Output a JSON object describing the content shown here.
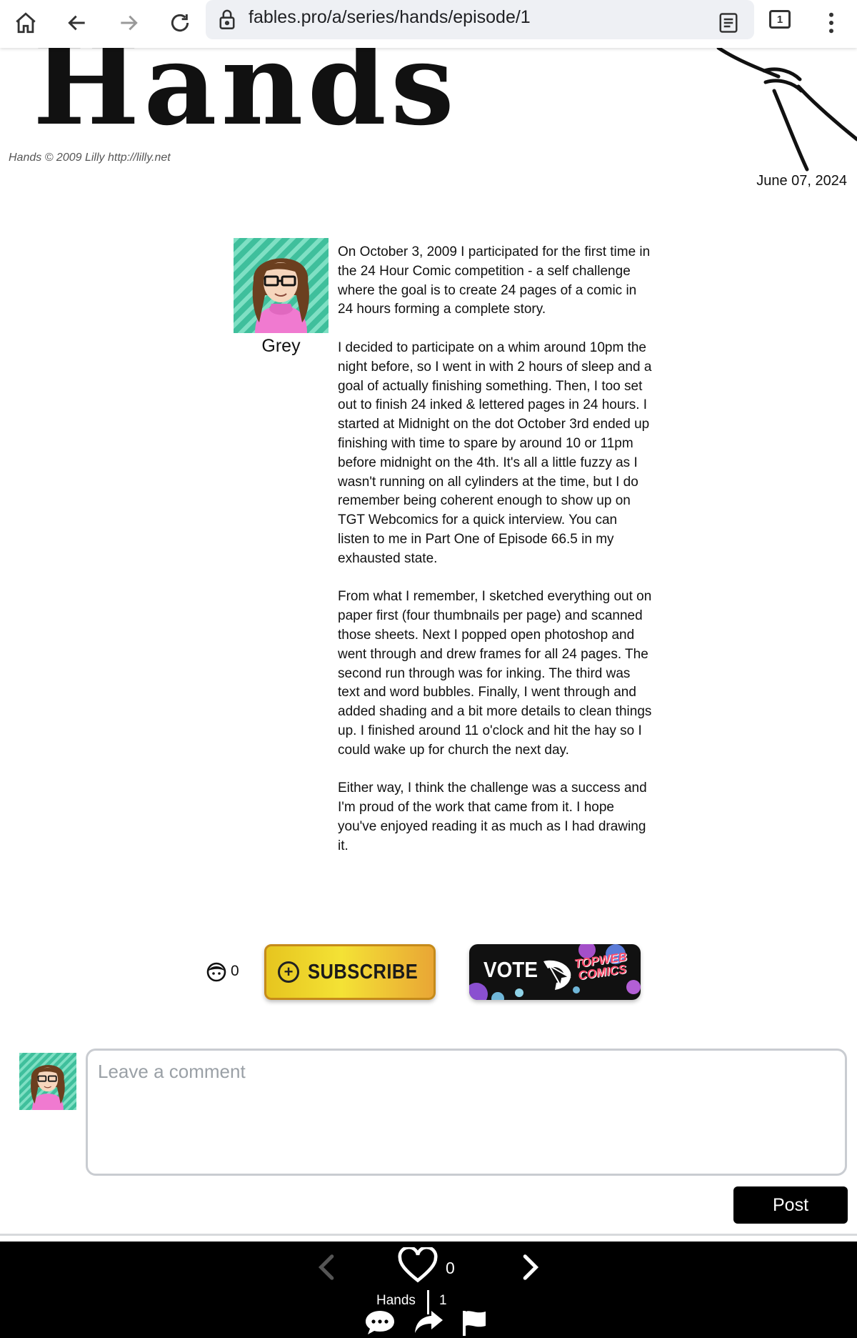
{
  "browser": {
    "url": "fables.pro/a/series/hands/episode/1",
    "tab_count": "1"
  },
  "banner": {
    "title": "Hands",
    "copyright": "Hands © 2009 Lilly http://lilly.net"
  },
  "post": {
    "date": "June 07, 2024",
    "author": "Grey",
    "paragraphs": [
      "On October 3, 2009 I participated for the first time in the 24 Hour Comic competition - a self challenge where the goal is to create 24 pages of a comic in 24 hours forming a complete story.",
      "I decided to participate on a whim around 10pm the night before, so I went in with 2 hours of sleep and a goal of actually finishing something. Then, I too set out to finish 24 inked & lettered pages in 24 hours. I started at Midnight on the dot October 3rd ended up finishing with time to spare by around 10 or 11pm before midnight on the 4th. It's all a little fuzzy as I wasn't running on all cylinders at the time, but I do remember being coherent enough to show up on TGT Webcomics for a quick interview. You can listen to me in Part One of Episode 66.5 in my exhausted state.",
      "From what I remember, I sketched everything out on paper first (four thumbnails per page) and scanned those sheets. Next I popped open photoshop and went through and drew frames for all 24 pages. The second run through was for inking. The third was text and word bubbles. Finally, I went through and added shading and a bit more details to clean things up. I finished around 11 o'clock and hit the hay so I could wake up for church the next day.",
      "Either way, I think the challenge was a success and I'm proud of the work that came from it. I hope you've enjoyed reading it as much as I had drawing it."
    ]
  },
  "reactions": {
    "reader_count": "0",
    "subscribe_label": "SUBSCRIBE",
    "vote_label": "VOTE",
    "vote_brand_line1": "TOPWEB",
    "vote_brand_line2": "COMICS"
  },
  "comment": {
    "placeholder": "Leave a comment",
    "post_label": "Post"
  },
  "bottom_bar": {
    "like_count": "0",
    "series_name": "Hands",
    "episode_number": "1"
  },
  "colors": {
    "avatar_bg": "#3fbf9c",
    "avatar_sweater": "#f07ad0",
    "avatar_hair": "#6b3f1f",
    "bottom_bar_bg": "#000000"
  }
}
